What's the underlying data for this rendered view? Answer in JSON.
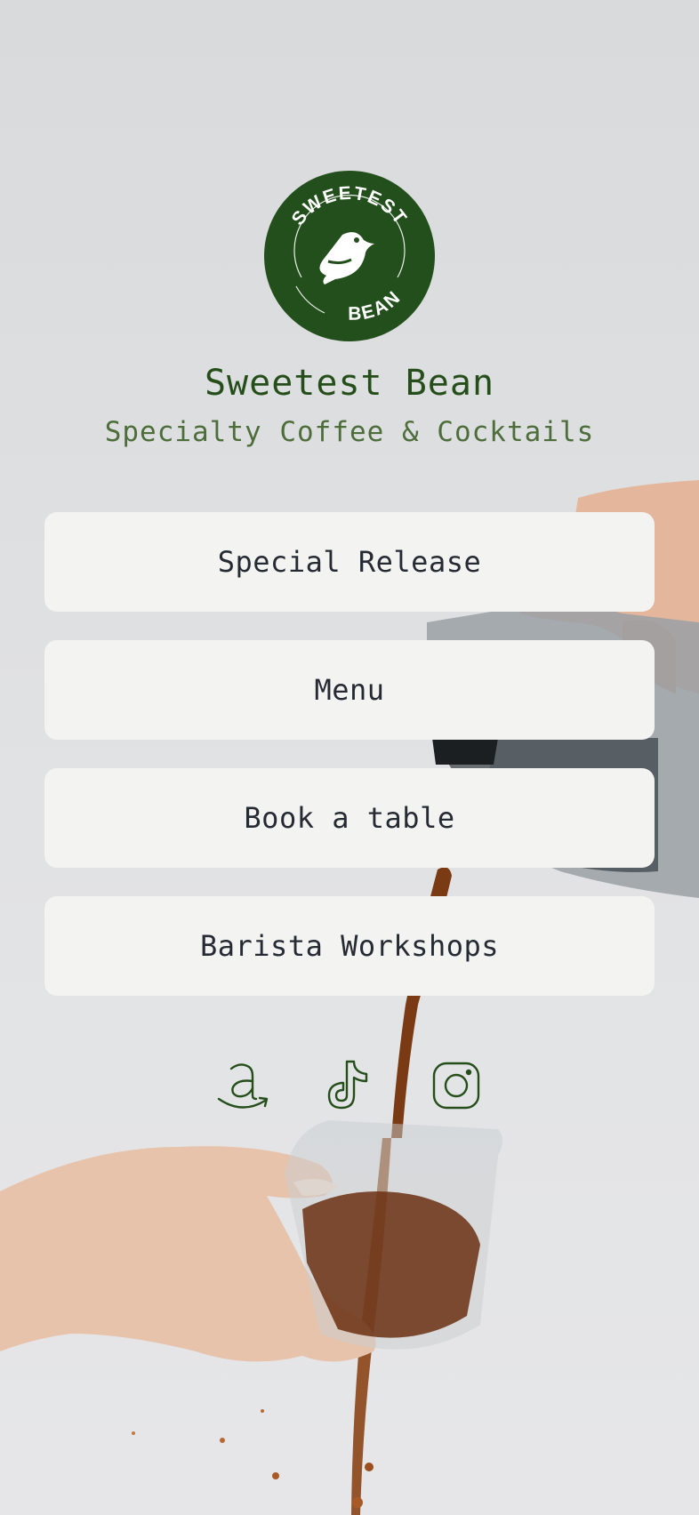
{
  "brand": {
    "name": "Sweetest Bean",
    "tagline": "Specialty Coffee & Cocktails",
    "logo_top": "SWEETEST",
    "logo_bottom": "BEAN",
    "logo_color": "#234f1c"
  },
  "links": [
    {
      "label": "Special Release"
    },
    {
      "label": "Menu"
    },
    {
      "label": "Book a table"
    },
    {
      "label": "Barista Workshops"
    }
  ],
  "socials": [
    {
      "icon": "amazon-icon"
    },
    {
      "icon": "tiktok-icon"
    },
    {
      "icon": "instagram-icon"
    }
  ],
  "colors": {
    "accent": "#254e1a",
    "button_bg": "#f3f3f2",
    "button_text": "#262b33"
  }
}
